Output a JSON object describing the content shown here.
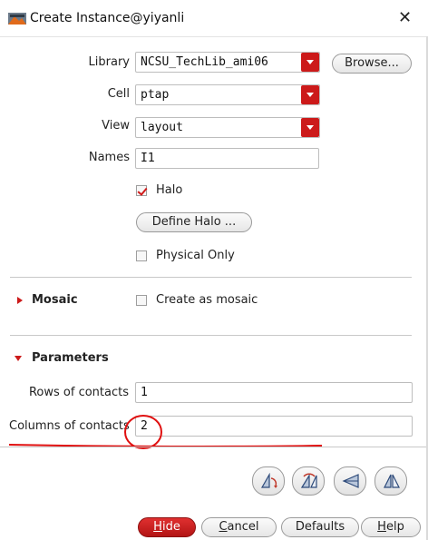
{
  "window": {
    "title": "Create Instance@yiyanli",
    "close_glyph": "✕"
  },
  "form": {
    "library_label": "Library",
    "library_value": "NCSU_TechLib_ami06",
    "browse_label": "Browse...",
    "cell_label": "Cell",
    "cell_value": "ptap",
    "view_label": "View",
    "view_value": "layout",
    "names_label": "Names",
    "names_value": "I1",
    "halo_label": "Halo",
    "halo_checked": true,
    "define_halo_label": "Define Halo ...",
    "physical_only_label": "Physical Only",
    "physical_only_checked": false
  },
  "mosaic": {
    "title": "Mosaic",
    "collapsed": true,
    "create_as_mosaic_label": "Create as mosaic",
    "create_as_mosaic_checked": false
  },
  "parameters": {
    "title": "Parameters",
    "expanded": true,
    "rows_label": "Rows of contacts",
    "rows_value": "1",
    "columns_label": "Columns of contacts",
    "columns_value": "2"
  },
  "toolbar": {
    "icons": [
      "rotate-icon",
      "sideways-icon",
      "upside-down-icon",
      "mirror-icon"
    ]
  },
  "buttons": {
    "hide": {
      "prefix": "",
      "underlined": "H",
      "rest": "ide"
    },
    "cancel": {
      "prefix": "",
      "underlined": "C",
      "rest": "ancel"
    },
    "defaults": "Defaults",
    "help": {
      "prefix": "",
      "underlined": "H",
      "rest": "elp"
    }
  },
  "colors": {
    "accent_red": "#cc1a1a",
    "annotation_red": "#e01010"
  }
}
